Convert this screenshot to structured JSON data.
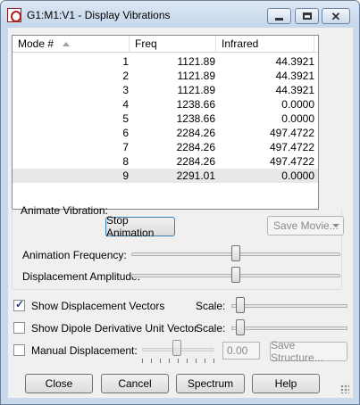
{
  "window": {
    "title": "G1:M1:V1 - Display Vibrations",
    "buttons": {
      "minimize": "minimize",
      "maximize": "maximize",
      "close": "close"
    }
  },
  "table": {
    "columns": [
      "Mode #",
      "Freq",
      "Infrared"
    ],
    "rows": [
      {
        "mode": "1",
        "freq": "1121.89",
        "ir": "44.3921"
      },
      {
        "mode": "2",
        "freq": "1121.89",
        "ir": "44.3921"
      },
      {
        "mode": "3",
        "freq": "1121.89",
        "ir": "44.3921"
      },
      {
        "mode": "4",
        "freq": "1238.66",
        "ir": "0.0000"
      },
      {
        "mode": "5",
        "freq": "1238.66",
        "ir": "0.0000"
      },
      {
        "mode": "6",
        "freq": "2284.26",
        "ir": "497.4722"
      },
      {
        "mode": "7",
        "freq": "2284.26",
        "ir": "497.4722"
      },
      {
        "mode": "8",
        "freq": "2284.26",
        "ir": "497.4722"
      },
      {
        "mode": "9",
        "freq": "2291.01",
        "ir": "0.0000"
      }
    ],
    "selected_mode": "9"
  },
  "animate": {
    "group_label": "Animate Vibration:",
    "stop_button": "Stop Animation",
    "save_movie": "Save Movie...",
    "frequency_label": "Animation Frequency:",
    "frequency_level": 0.5,
    "amplitude_label": "Displacement Amplitude:",
    "amplitude_level": 0.5
  },
  "options": {
    "show_vectors": {
      "label": "Show Displacement Vectors",
      "checked": true,
      "scale_label": "Scale:"
    },
    "show_dipole": {
      "label": "Show Dipole Derivative Unit Vector",
      "checked": false,
      "scale_label": "Scale:"
    },
    "manual": {
      "label": "Manual Displacement:",
      "checked": false,
      "value": "0.00",
      "save_structure": "Save Structure..."
    }
  },
  "footer": {
    "close": "Close",
    "cancel": "Cancel",
    "spectrum": "Spectrum",
    "help": "Help"
  },
  "colors": {
    "titlebar": "#c9d8ea",
    "selected_row": "#e8e8e8",
    "focus_border": "#3c7fb1"
  }
}
